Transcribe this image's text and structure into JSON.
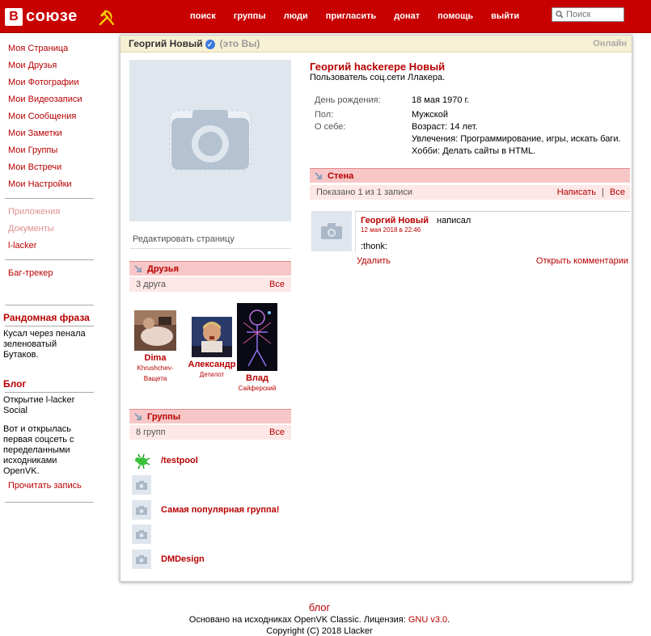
{
  "header": {
    "logo_letter": "В",
    "logo_text": "союзе",
    "nav": [
      "поиск",
      "группы",
      "люди",
      "пригласить",
      "донат",
      "помощь",
      "выйти"
    ],
    "search_placeholder": "Поиск"
  },
  "sidebar": {
    "menu": [
      "Моя Страница",
      "Мои Друзья",
      "Мои Фотографии",
      "Мои Видеозаписи",
      "Мои Сообщения",
      "Мои Заметки",
      "Мои Группы",
      "Мои Встречи",
      "Мои Настройки"
    ],
    "extra": [
      "Приложения",
      "Документы"
    ],
    "llacker": "l-lacker",
    "bugtracker": "Баг-трекер",
    "random_title": "Рандомная фраза",
    "random_text": "Кусал через пенала зеленоватый Бутаков.",
    "blog_title": "Блог",
    "blog_post_title": "Открытие l-lacker Social",
    "blog_post_text": "Вот и открылась первая соцсеть с переделанными исходниками OpenVK.",
    "blog_read": "Прочитать запись"
  },
  "profile": {
    "topbar_name": "Георгий Новый",
    "topbar_me": "(это Вы)",
    "topbar_status": "Онлайн",
    "edit_label": "Редактировать страницу",
    "full_name": "Георгий hackerepe Новый",
    "subtitle": "Пользователь соц.сети Ллакера.",
    "info": [
      {
        "label": "День рождения:",
        "value": "18 мая 1970 г."
      },
      {
        "label": "Пол:",
        "value": "Мужской"
      },
      {
        "label": "О себе:",
        "value": "Возраст: 14 лет."
      },
      {
        "label": "",
        "value": "Увлечения: Программирование, игры, искать баги."
      },
      {
        "label": "",
        "value": "Хобби: Делать сайты в HTML."
      }
    ]
  },
  "friends": {
    "title": "Друзья",
    "count": "3 друга",
    "all": "Все",
    "list": [
      {
        "first": "Dima",
        "last": "Khrushchev-Ващета"
      },
      {
        "first": "Александр",
        "last": "Детилот"
      },
      {
        "first": "Влад",
        "last": "Сайферский"
      }
    ]
  },
  "groups": {
    "title": "Группы",
    "count": "8 групп",
    "all": "Все",
    "list": [
      "/testpool",
      "",
      "Самая популярная группа!",
      "",
      "DMDesign"
    ]
  },
  "wall": {
    "title": "Стена",
    "shown": "Показано 1 из 1 записи",
    "write": "Написать",
    "sep": "|",
    "all": "Все",
    "post": {
      "author": "Георгий Новый",
      "wrote": "написал",
      "date": "12 мая 2018 в 22:46",
      "text": ":thonk:",
      "delete": "Удалить",
      "comments": "Открыть комментарии"
    }
  },
  "footer": {
    "blog": "блог",
    "license_text": "Основано на исходниках OpenVK Classic. Лицензия: ",
    "license_link": "GNU v3.0",
    "license_end": ".",
    "copyright": "Copyright (C) 2018 Llacker"
  }
}
